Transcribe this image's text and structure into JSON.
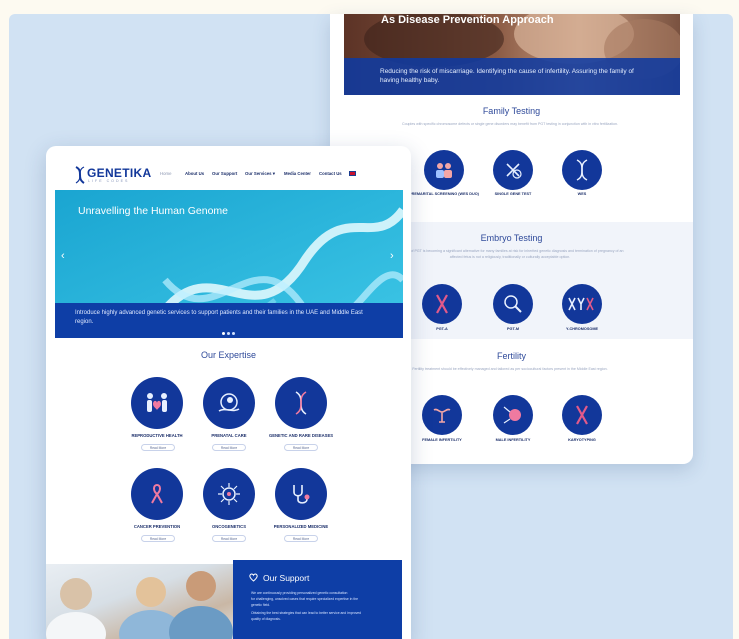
{
  "back": {
    "hero_title": "As Disease Prevention Approach",
    "hero_text": "Reducing the risk of miscarriage. Identifying the cause of infertility. Assuring the family of having healthy baby.",
    "family": {
      "title": "Family Testing",
      "desc": "Couples with specific chromosome defects or single gene disorders may benefit from PGT testing in conjunction with in vitro fertilization.",
      "items": [
        {
          "label": "PREMARITAL SCREENING (WES DUO)",
          "icon": "couple-icon"
        },
        {
          "label": "SINGLE GENE TEST",
          "icon": "gene-test-icon"
        },
        {
          "label": "WES",
          "icon": "dna-icon"
        }
      ]
    },
    "embryo": {
      "title": "Embryo Testing",
      "desc": "The use of PGT is becoming a significant alternative for many families at risk for inherited genetic diagnosis and termination of pregnancy of an affected fetus is not a religiously, traditionally or culturally acceptable option.",
      "items": [
        {
          "label": "PGT-A",
          "icon": "chromosome-icon"
        },
        {
          "label": "PGT-M",
          "icon": "magnifier-icon"
        },
        {
          "label": "Y-CHROMOSOME",
          "icon": "xy-chromosome-icon"
        }
      ]
    },
    "fertility": {
      "title": "Fertility",
      "desc": "Fertility treatment should be effectively managed and tailored as per sociocultural factors present in the Middle East region.",
      "items": [
        {
          "label": "FEMALE INFERTILITY",
          "icon": "uterus-icon"
        },
        {
          "label": "MALE INFERTILITY",
          "icon": "sperm-egg-icon"
        },
        {
          "label": "KARYOTYPING",
          "icon": "karyotype-icon"
        }
      ]
    }
  },
  "front": {
    "logo": {
      "name": "GENETIKA",
      "sub": "LIFE CODES"
    },
    "nav": [
      "Home",
      "About Us",
      "Our Support",
      "Our Services",
      "Media Center",
      "Contact Us"
    ],
    "hero": {
      "title": "Unravelling the Human Genome",
      "text": "Introduce highly advanced genetic services to support patients and their families in the UAE and Middle East region."
    },
    "expertise": {
      "title": "Our Expertise",
      "read_more": "Read More",
      "items": [
        {
          "label": "REPRODUCTIVE HEALTH",
          "icon": "family-heart-icon"
        },
        {
          "label": "PRENATAL CARE",
          "icon": "fetus-icon"
        },
        {
          "label": "GENETIC AND RARE DISEASES",
          "icon": "dna-icon"
        },
        {
          "label": "CANCER PREVENTION",
          "icon": "ribbon-icon"
        },
        {
          "label": "ONCOGENETICS",
          "icon": "cell-icon"
        },
        {
          "label": "PERSONALIZED MEDICINE",
          "icon": "stethoscope-icon"
        }
      ]
    },
    "support": {
      "title": "Our Support",
      "lines": [
        "We are continuously providing personalized genetic consultation",
        "for challenging, unsolved cases that require specialized expertise in the",
        "genetic field.",
        "Obtaining the best strategies that can lead to better service and improved",
        "quality of diagnosis."
      ]
    }
  },
  "colors": {
    "brand_blue": "#12379a",
    "band_blue": "#0e3ea6",
    "page_bg": "#d1e2f3"
  }
}
